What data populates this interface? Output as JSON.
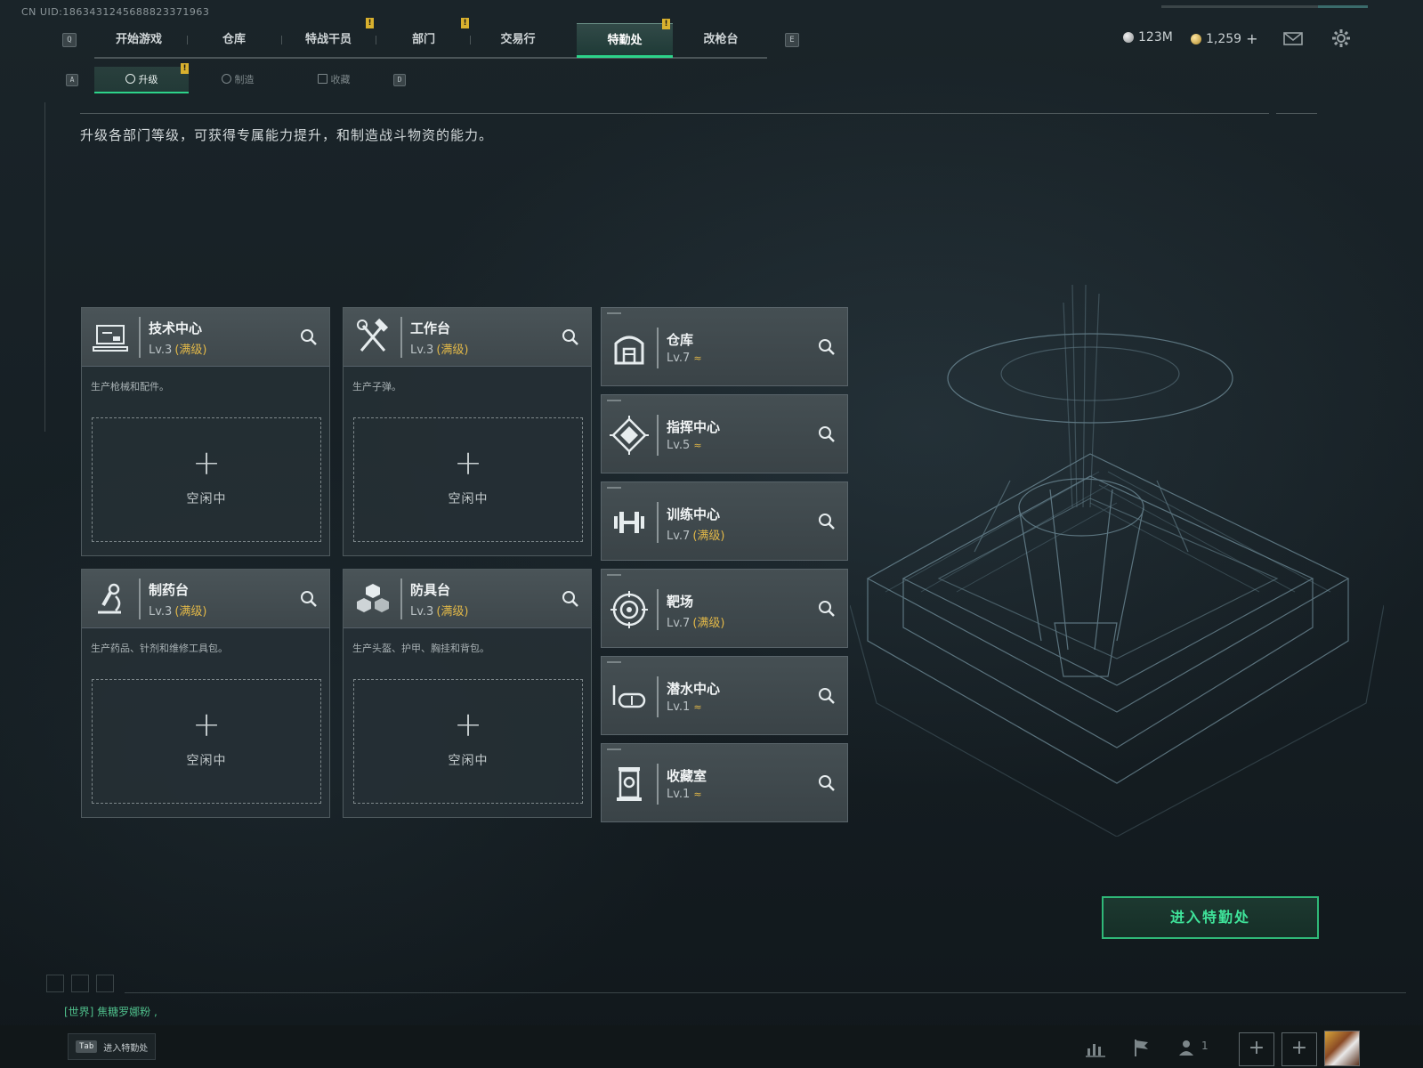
{
  "uid": "CN UID:1863431245688823371963",
  "nav": {
    "key_left": "Q",
    "key_right": "E",
    "tabs": [
      {
        "label": "开始游戏",
        "alert": ""
      },
      {
        "label": "仓库",
        "alert": ""
      },
      {
        "label": "特战干员",
        "alert": "!"
      },
      {
        "label": "部门",
        "alert": "!"
      },
      {
        "label": "交易行",
        "alert": ""
      },
      {
        "label": "特勤处",
        "alert": "!"
      },
      {
        "label": "改枪台",
        "alert": ""
      }
    ],
    "active_tab": "特勤处"
  },
  "resources": {
    "silver": "123M",
    "gold": "1,259",
    "gold_add": "+"
  },
  "subnav": {
    "key_left": "A",
    "key_right": "D",
    "tabs": [
      {
        "label": "升级"
      },
      {
        "label": "制造"
      },
      {
        "label": "收藏"
      }
    ],
    "alert": "!"
  },
  "description": "升级各部门等级，可获得专属能力提升，和制造战斗物资的能力。",
  "workstations": [
    {
      "name": "技术中心",
      "level": "Lv.3",
      "max": "(满级)",
      "desc": "生产枪械和配件。",
      "icon": "computer-icon",
      "slot_plus": "+",
      "slot_status": "空闲中"
    },
    {
      "name": "工作台",
      "level": "Lv.3",
      "max": "(满级)",
      "desc": "生产子弹。",
      "icon": "hammer-wrench-icon",
      "slot_plus": "+",
      "slot_status": "空闲中"
    },
    {
      "name": "制药台",
      "level": "Lv.3",
      "max": "(满级)",
      "desc": "生产药品、针剂和维修工具包。",
      "icon": "microscope-icon",
      "slot_plus": "+",
      "slot_status": "空闲中"
    },
    {
      "name": "防具台",
      "level": "Lv.3",
      "max": "(满级)",
      "desc": "生产头盔、护甲、胸挂和背包。",
      "icon": "armor-blocks-icon",
      "slot_plus": "+",
      "slot_status": "空闲中"
    }
  ],
  "facilities": [
    {
      "name": "仓库",
      "level": "Lv.7",
      "max": "",
      "upgradable": true,
      "icon": "warehouse-icon"
    },
    {
      "name": "指挥中心",
      "level": "Lv.5",
      "max": "",
      "upgradable": true,
      "icon": "command-chip-icon"
    },
    {
      "name": "训练中心",
      "level": "Lv.7",
      "max": "(满级)",
      "upgradable": false,
      "icon": "dumbbell-icon"
    },
    {
      "name": "靶场",
      "level": "Lv.7",
      "max": "(满级)",
      "upgradable": false,
      "icon": "target-icon"
    },
    {
      "name": "潜水中心",
      "level": "Lv.1",
      "max": "",
      "upgradable": true,
      "icon": "diving-mask-icon"
    },
    {
      "name": "收藏室",
      "level": "Lv.1",
      "max": "",
      "upgradable": true,
      "icon": "display-case-icon"
    }
  ],
  "upgrade_glyph": "≈",
  "enter_button": "进入特勤处",
  "chat_line": "[世界] 焦糖罗娜粉 ,",
  "bottom": {
    "tab_key": "Tab",
    "tab_label": "进入特勤处",
    "friends_count": "1",
    "plus": "+"
  },
  "colors": {
    "accent_green": "#2dd38a",
    "max_level_gold": "#e2b848",
    "alert_yellow": "#d9b12e"
  }
}
